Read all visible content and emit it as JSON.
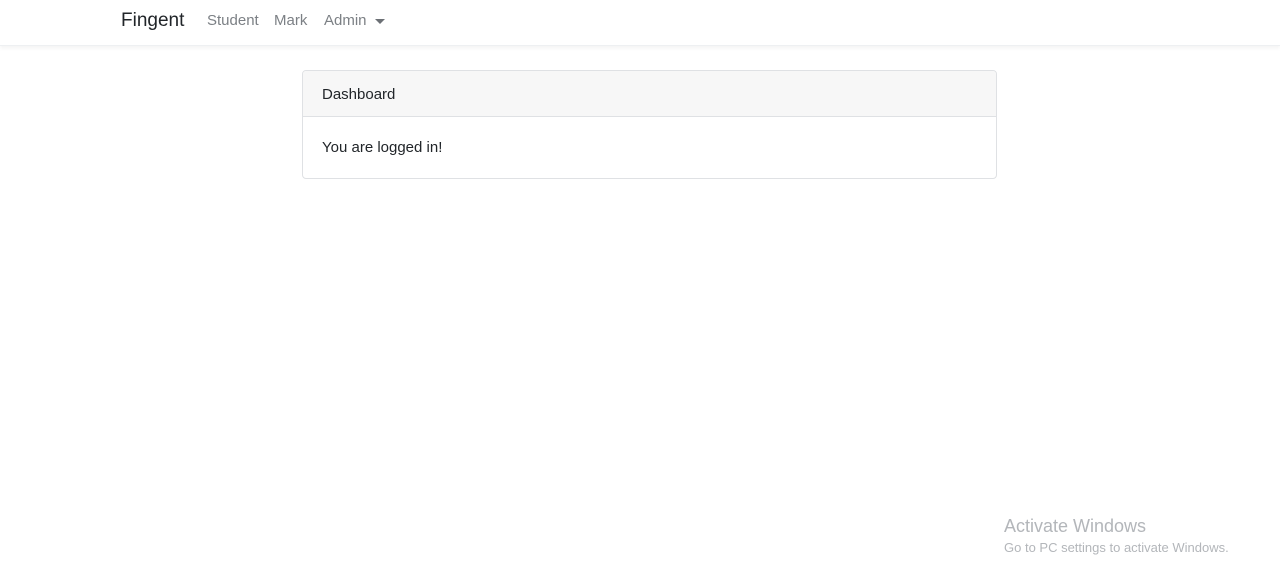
{
  "navbar": {
    "brand": "Fingent",
    "items": [
      {
        "label": "Student"
      },
      {
        "label": "Mark"
      },
      {
        "label": "Admin",
        "dropdown": true
      }
    ]
  },
  "card": {
    "header": "Dashboard",
    "body": "You are logged in!"
  },
  "watermark": {
    "title": "Activate Windows",
    "subtitle": "Go to PC settings to activate Windows."
  },
  "colors": {
    "nav_link": "#7c8085",
    "card_header_bg": "#f7f7f7",
    "border": "#dfe1e4"
  }
}
